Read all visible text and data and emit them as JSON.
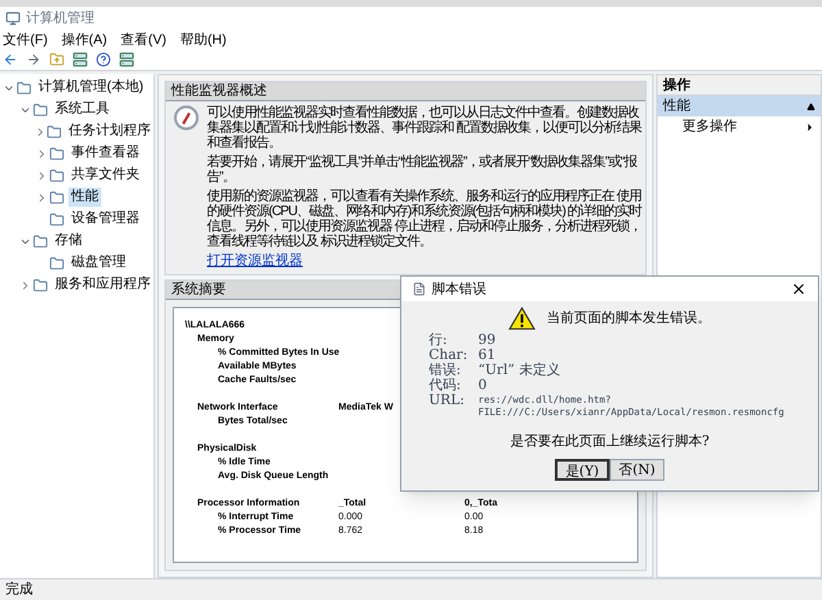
{
  "window": {
    "title": "计算机管理"
  },
  "menu": [
    "文件(F)",
    "操作(A)",
    "查看(V)",
    "帮助(H)"
  ],
  "tree": [
    {
      "label": "计算机管理(本地)",
      "expanded": true,
      "selected": false,
      "children": [
        {
          "label": "系统工具",
          "expanded": true,
          "selected": false,
          "children": [
            {
              "label": "任务计划程序",
              "expanded": false,
              "selected": false
            },
            {
              "label": "事件查看器",
              "expanded": false,
              "selected": false
            },
            {
              "label": "共享文件夹",
              "expanded": false,
              "selected": false
            },
            {
              "label": "性能",
              "expanded": false,
              "selected": true
            },
            {
              "label": "设备管理器",
              "selected": false
            }
          ]
        },
        {
          "label": "存储",
          "expanded": true,
          "selected": false,
          "children": [
            {
              "label": "磁盘管理",
              "selected": false
            }
          ]
        },
        {
          "label": "服务和应用程序",
          "expanded": false,
          "selected": false
        }
      ]
    }
  ],
  "overview": {
    "title": "性能监视器概述",
    "paragraphs": [
      "可以使用性能监视器实时查看性能数据，也可以从日志文件中查看。创建数据收集器集以配置和计划性能计数器、事件跟踪和 配置数据收集，以便可以分析结果和查看报告。",
      "若要开始，请展开“监视工具”并单击“性能监视器”，或者展开“数据收集器集”或“报告”。",
      "使用新的资源监视器，可以查看有关操作系统、服务和运行的应用程序正在 使用的硬件资源(CPU、磁盘、网络和内存)和系统资源(包括句柄和模块) 的详细的实时信息。另外，可以使用资源监视器 停止进程，启动和停止服务，分析进程死锁，查看线程等待链以及 标识进程锁定文件。"
    ],
    "link": "打开资源监视器"
  },
  "summary": {
    "title": "系统摘要",
    "machine": "\\\\LALALA666",
    "groups": [
      {
        "name": "Memory",
        "counters": [
          {
            "name": "% Committed Bytes In Use"
          },
          {
            "name": "Available MBytes"
          },
          {
            "name": "Cache Faults/sec"
          }
        ]
      },
      {
        "name": "Network Interface",
        "instances": [
          "MediaTek W"
        ],
        "counters": [
          {
            "name": "Bytes Total/sec"
          }
        ]
      },
      {
        "name": "PhysicalDisk",
        "counters": [
          {
            "name": "% Idle Time"
          },
          {
            "name": "Avg. Disk Queue Length"
          }
        ]
      },
      {
        "name": "Processor Information",
        "instances": [
          "_Total",
          "0,_Tota"
        ],
        "counters": [
          {
            "name": "% Interrupt Time",
            "values": [
              "0.000",
              "0.00"
            ]
          },
          {
            "name": "% Processor Time",
            "values": [
              "8.762",
              "8.18"
            ]
          }
        ]
      }
    ]
  },
  "actions": {
    "title": "操作",
    "section": {
      "label": "性能",
      "expanded": true
    },
    "items": [
      "更多操作"
    ]
  },
  "dialog": {
    "title": "脚本错误",
    "message": "当前页面的脚本发生错误。",
    "details": [
      {
        "label": "行:",
        "value": "99"
      },
      {
        "label": "Char:",
        "value": "61"
      },
      {
        "label": "错误:",
        "value": "“Url” 未定义"
      },
      {
        "label": "代码:",
        "value": "0"
      },
      {
        "label": "URL:",
        "value": "res://wdc.dll/home.htm?\nFILE:///C:/Users/xianr/AppData/Local/resmon.resmoncfg"
      }
    ],
    "question": "是否要在此页面上继续运行脚本?",
    "buttons": [
      {
        "label": "是(Y)",
        "selected": true
      },
      {
        "label": "否(N)",
        "selected": false
      }
    ]
  },
  "status_bar": "完成"
}
